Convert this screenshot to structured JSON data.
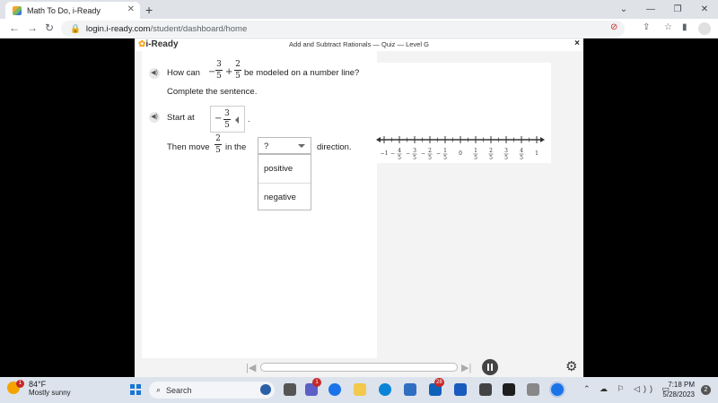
{
  "browser": {
    "tab_title": "Math To Do, i-Ready",
    "url_host": "login.i-ready.com",
    "url_path": "/student/dashboard/home"
  },
  "app": {
    "logo": "i-Ready",
    "title": "Add and Subtract Rationals — Quiz — Level G",
    "close_label": "×"
  },
  "question": {
    "prompt_prefix": "How can",
    "term1_sign": "−",
    "term1_num": "3",
    "term1_den": "5",
    "operator": "+",
    "term2_num": "2",
    "term2_den": "5",
    "prompt_suffix": "be modeled on a number line?",
    "instruction": "Complete the sentence.",
    "start_label": "Start at",
    "start_sign": "−",
    "start_num": "3",
    "start_den": "5",
    "start_period": ".",
    "move_label": "Then move",
    "move_num": "2",
    "move_den": "5",
    "in_the": "in the",
    "dropdown_value": "?",
    "dropdown_options": [
      "positive",
      "negative"
    ],
    "direction_label": "direction."
  },
  "number_line": {
    "min": -1,
    "max": 1,
    "step_denominator": 5,
    "labels": [
      {
        "sign": "−",
        "num": "1",
        "den": ""
      },
      {
        "sign": "−",
        "num": "4",
        "den": "5"
      },
      {
        "sign": "−",
        "num": "3",
        "den": "5"
      },
      {
        "sign": "−",
        "num": "2",
        "den": "5"
      },
      {
        "sign": "−",
        "num": "1",
        "den": "5"
      },
      {
        "sign": "",
        "num": "0",
        "den": ""
      },
      {
        "sign": "",
        "num": "1",
        "den": "5"
      },
      {
        "sign": "",
        "num": "2",
        "den": "5"
      },
      {
        "sign": "",
        "num": "3",
        "den": "5"
      },
      {
        "sign": "",
        "num": "4",
        "den": "5"
      },
      {
        "sign": "",
        "num": "1",
        "den": ""
      }
    ]
  },
  "taskbar": {
    "temperature": "84°F",
    "weather": "Mostly sunny",
    "weather_badge": "1",
    "search_label": "Search",
    "teams_badge": "1",
    "mail_badge": "28",
    "time": "7:18 PM",
    "date": "5/28/2023",
    "notifications": "2"
  }
}
